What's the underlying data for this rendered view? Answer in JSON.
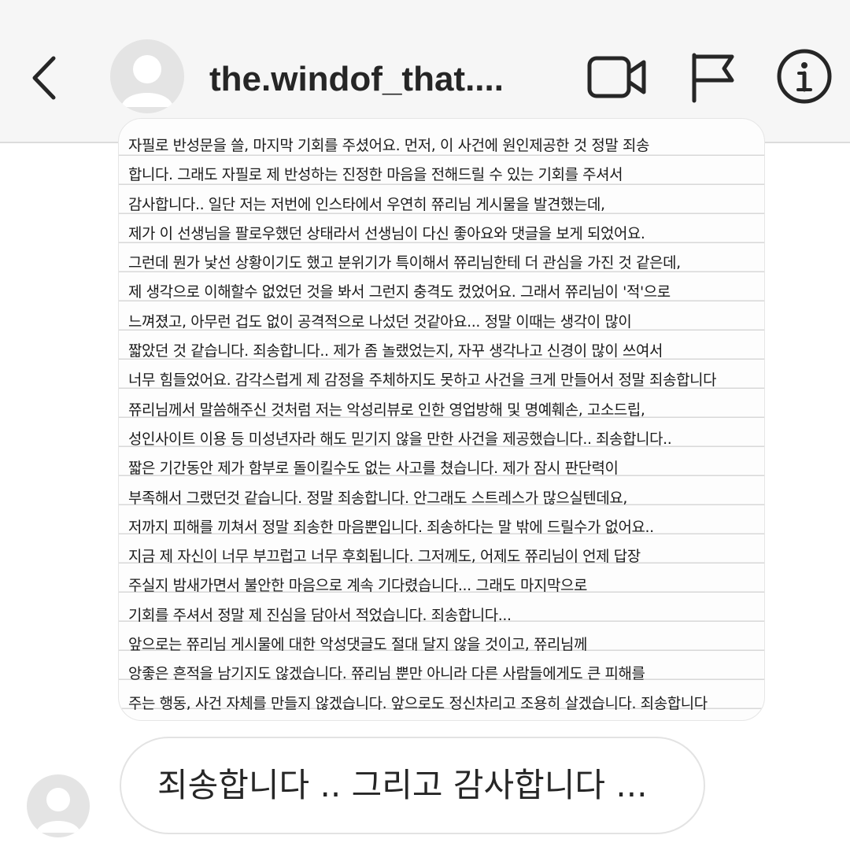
{
  "header": {
    "username": "the.windof_that....",
    "icons": {
      "back": "chevron-left-icon",
      "video": "video-call-icon",
      "flag": "flag-icon",
      "info": "info-icon"
    }
  },
  "note": {
    "lines": [
      "자필로 반성문을 쓸, 마지막 기회를 주셨어요. 먼저, 이 사건에 원인제공한 것 정말 죄송",
      "합니다. 그래도 자필로 제 반성하는 진정한 마음을 전해드릴 수 있는 기회를 주셔서",
      "감사합니다.. 일단 저는 저번에 인스타에서 우연히 쮸리님 게시물을 발견했는데,",
      "제가 이 선생님을 팔로우했던 상태라서 선생님이 다신 좋아요와 댓글을 보게 되었어요.",
      "그런데 뭔가 낯선 상황이기도 했고 분위기가 특이해서 쮸리님한테 더 관심을 가진 것 같은데,",
      "제 생각으로 이해할수 없었던 것을 봐서 그런지 충격도 컸었어요. 그래서 쮸리님이 '적'으로",
      "느껴졌고, 아무런 겁도 없이 공격적으로 나섰던 것같아요... 정말 이때는 생각이 많이",
      "짧았던 것 같습니다. 죄송합니다.. 제가 좀 놀랬었는지, 자꾸 생각나고 신경이 많이 쓰여서",
      "너무 힘들었어요. 감각스럽게 제 감정을 주체하지도 못하고 사건을 크게 만들어서 정말 죄송합니다",
      " 쮸리님께서 말씀해주신 것처럼 저는 악성리뷰로 인한 영업방해 및 명예훼손, 고소드립,",
      "성인사이트 이용 등 미성년자라 해도 믿기지 않을 만한 사건을 제공했습니다.. 죄송합니다..",
      "짧은 기간동안 제가 함부로 돌이킬수도 없는 사고를 쳤습니다. 제가 잠시 판단력이",
      "부족해서 그랬던것 같습니다. 정말 죄송합니다. 안그래도 스트레스가 많으실텐데요,",
      "저까지 피해를 끼쳐서 정말 죄송한 마음뿐입니다. 죄송하다는 말 밖에 드릴수가 없어요..",
      "지금 제 자신이 너무 부끄럽고 너무 후회됩니다. 그저께도, 어제도 쮸리님이 언제 답장",
      "주실지 밤새가면서 불안한 마음으로 계속 기다렸습니다... 그래도 마지막으로",
      "기회를 주셔서 정말 제 진심을 담아서 적었습니다. 죄송합니다...",
      " 앞으로는 쮸리님 게시물에 대한 악성댓글도 절대 달지 않을 것이고, 쮸리님께",
      "앙좋은 흔적을 남기지도 않겠습니다. 쮸리님 뿐만 아니라 다른 사람들에게도 큰 피해를",
      "주는 행동, 사건 자체를 만들지 않겠습니다. 앞으로도 정신차리고 조용히 살겠습니다. 죄송합니다"
    ]
  },
  "message": {
    "text": "죄송합니다 .. 그리고 감사합니다 ...",
    "avatar_icon": "user-avatar-icon"
  },
  "colors": {
    "header_bg": "#f6f6f6",
    "bubble_border": "#e3e3e3",
    "text": "#262626"
  }
}
